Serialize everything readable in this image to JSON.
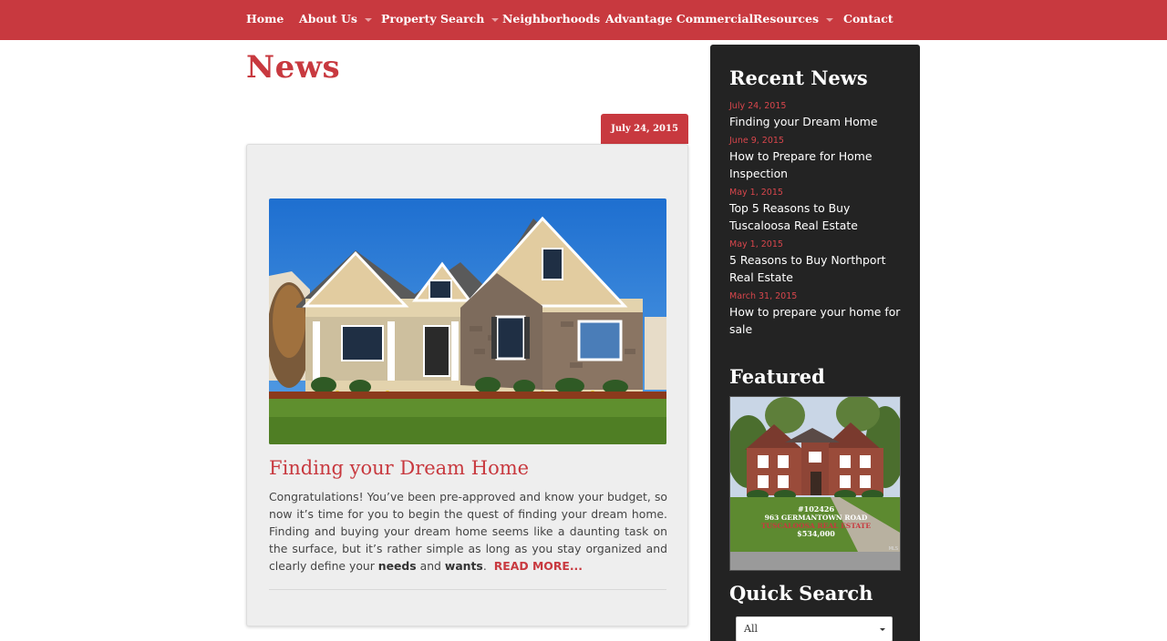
{
  "nav": {
    "items": [
      {
        "label": "Home",
        "dropdown": false
      },
      {
        "label": "About Us",
        "dropdown": true
      },
      {
        "label": "Property Search",
        "dropdown": true
      },
      {
        "label": "Neighborhoods",
        "dropdown": false
      },
      {
        "label": "Advantage Commercial",
        "dropdown": false
      },
      {
        "label": "Resources",
        "dropdown": true
      },
      {
        "label": "Contact",
        "dropdown": false
      }
    ]
  },
  "page": {
    "title": "News"
  },
  "post": {
    "date": "July 24, 2015",
    "title": "Finding your Dream Home",
    "excerpt_1": "Congratulations! You’ve been pre-approved and know your budget, so now it’s time for you to begin the quest of finding your dream home. Finding and buying your dream home seems like a daunting task on the surface, but it’s rather simple as long as you stay organized and clearly define your ",
    "needs": "needs",
    "and": " and ",
    "wants": "wants",
    "period": ".",
    "read_more": "READ MORE..."
  },
  "sidebar": {
    "recent_heading": "Recent News",
    "news": [
      {
        "date": "July 24, 2015",
        "title": "Finding your Dream Home"
      },
      {
        "date": "June 9, 2015",
        "title": "How to Prepare for Home Inspection"
      },
      {
        "date": "May 1, 2015",
        "title": "Top 5 Reasons to Buy Tuscaloosa Real Estate"
      },
      {
        "date": "May 1, 2015",
        "title": "5 Reasons to Buy Northport Real Estate"
      },
      {
        "date": "March 31, 2015",
        "title": "How to prepare your home for sale"
      }
    ],
    "featured_heading": "Featured",
    "featured": {
      "mls": "#102426",
      "address": "963 GERMANTOWN ROAD",
      "status": "TUSCALOOSA REAL ESTATE",
      "price": "$534,000",
      "badge": "MLS"
    },
    "quick_search_heading": "Quick Search",
    "select_value": "All"
  },
  "colors": {
    "brand_red": "#c8393f",
    "sidebar_bg": "#232323",
    "card_bg": "#eeeeee"
  }
}
